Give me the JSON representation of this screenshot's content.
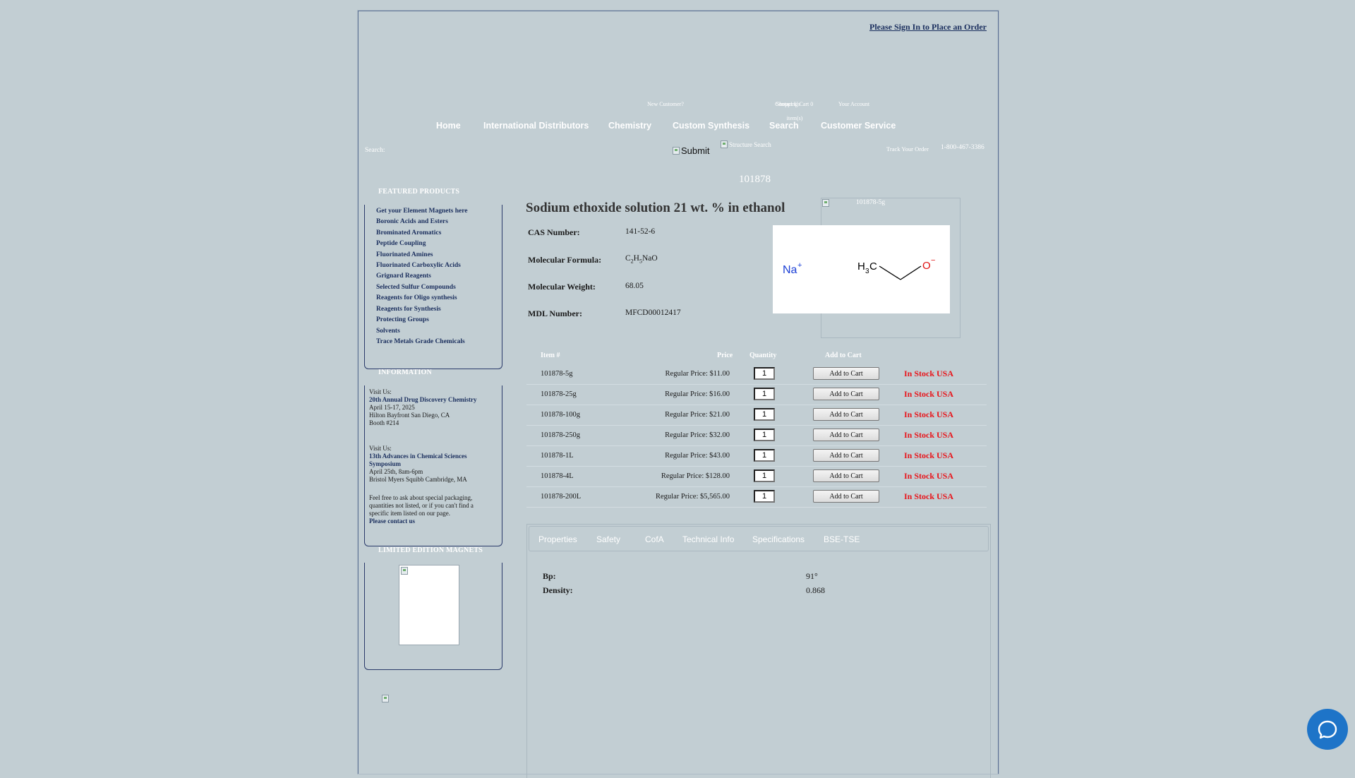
{
  "header": {
    "signin_link": "Please Sign In to Place an Order",
    "utility_links": [
      {
        "label": "New Customer?"
      },
      {
        "label": "Shopping Cart 0 item(s)"
      },
      {
        "label": "Contact Us"
      },
      {
        "label": "Your Account"
      }
    ],
    "nav": [
      {
        "label": "Home"
      },
      {
        "label": "International Distributors"
      },
      {
        "label": "Chemistry"
      },
      {
        "label": "Custom Synthesis"
      },
      {
        "label": "Search"
      },
      {
        "label": "Customer Service"
      }
    ],
    "search_label": "Search:",
    "submit_label": "Submit",
    "structure_search_label": "Structure Search",
    "track_order": "Track Your Order",
    "phone": "1-800-467-3386"
  },
  "sidebar": {
    "featured": {
      "heading": "FEATURED PRODUCTS",
      "items": [
        "Get your Element Magnets here",
        "Boronic Acids and Esters",
        "Brominated Aromatics",
        "Peptide Coupling",
        "Fluorinated Amines",
        "Fluorinated Carboxylic Acids",
        "Grignard Reagents",
        "Selected Sulfur Compounds",
        "Reagents for Oligo synthesis",
        "Reagents for Synthesis",
        "Protecting Groups",
        "Solvents",
        "Trace Metals Grade Chemicals"
      ]
    },
    "information": {
      "heading": "INFORMATION",
      "event1": {
        "visit": "Visit Us:",
        "title": "20th Annual Drug Discovery Chemistry",
        "date": "April 15-17, 2025",
        "location": "Hilton Bayfront San Diego, CA",
        "booth": "Booth #214"
      },
      "event2": {
        "visit": "Visit Us:",
        "title": "13th Advances in Chemical Sciences Symposium",
        "date": "April 25th, 8am-6pm",
        "location": "Bristol Myers Squibb Cambridge, MA"
      },
      "note": "Feel free to ask about special packaging, quantities not listed, or if you can't find a specific item listed on our page.",
      "contact_link": "Please contact us"
    },
    "magnets": {
      "heading": "LIMITED EDITION MAGNETS"
    }
  },
  "product": {
    "id": "101878",
    "title": "Sodium ethoxide solution 21 wt. % in ethanol",
    "image_caption": "101878-5g",
    "properties": [
      {
        "label": "CAS Number:",
        "value": "141-52-6"
      },
      {
        "label": "Molecular Formula:",
        "value": "C2H5NaO"
      },
      {
        "label": "Molecular Weight:",
        "value": "68.05"
      },
      {
        "label": "MDL Number:",
        "value": "MFCD00012417"
      }
    ],
    "structure_labels": {
      "cation": "Na",
      "cation_charge": "+",
      "methyl_h": "H",
      "methyl_sub": "3",
      "methyl_c": "C",
      "anion": "O",
      "anion_charge": "−"
    }
  },
  "pricing": {
    "headers": {
      "item": "Item #",
      "price": "Price",
      "quantity": "Quantity",
      "add": "Add to Cart"
    },
    "rows": [
      {
        "item": "101878-5g",
        "price": "Regular Price: $11.00",
        "qty": "1",
        "button": "Add to Cart",
        "stock": "In Stock USA"
      },
      {
        "item": "101878-25g",
        "price": "Regular Price: $16.00",
        "qty": "1",
        "button": "Add to Cart",
        "stock": "In Stock USA"
      },
      {
        "item": "101878-100g",
        "price": "Regular Price: $21.00",
        "qty": "1",
        "button": "Add to Cart",
        "stock": "In Stock USA"
      },
      {
        "item": "101878-250g",
        "price": "Regular Price: $32.00",
        "qty": "1",
        "button": "Add to Cart",
        "stock": "In Stock USA"
      },
      {
        "item": "101878-1L",
        "price": "Regular Price: $43.00",
        "qty": "1",
        "button": "Add to Cart",
        "stock": "In Stock USA"
      },
      {
        "item": "101878-4L",
        "price": "Regular Price: $128.00",
        "qty": "1",
        "button": "Add to Cart",
        "stock": "In Stock USA"
      },
      {
        "item": "101878-200L",
        "price": "Regular Price: $5,565.00",
        "qty": "1",
        "button": "Add to Cart",
        "stock": "In Stock USA"
      }
    ]
  },
  "tabs": {
    "items": [
      {
        "label": "Properties"
      },
      {
        "label": "Safety"
      },
      {
        "label": "CofA"
      },
      {
        "label": "Technical Info"
      },
      {
        "label": "Specifications"
      },
      {
        "label": "BSE-TSE"
      }
    ],
    "properties": [
      {
        "label": "Bp:",
        "value": "91°"
      },
      {
        "label": "Density:",
        "value": "0.868"
      }
    ]
  },
  "colors": {
    "background": "#c2ced3",
    "link": "#1b2f5e",
    "stock": "#e8151b",
    "chat": "#1e74c8"
  }
}
